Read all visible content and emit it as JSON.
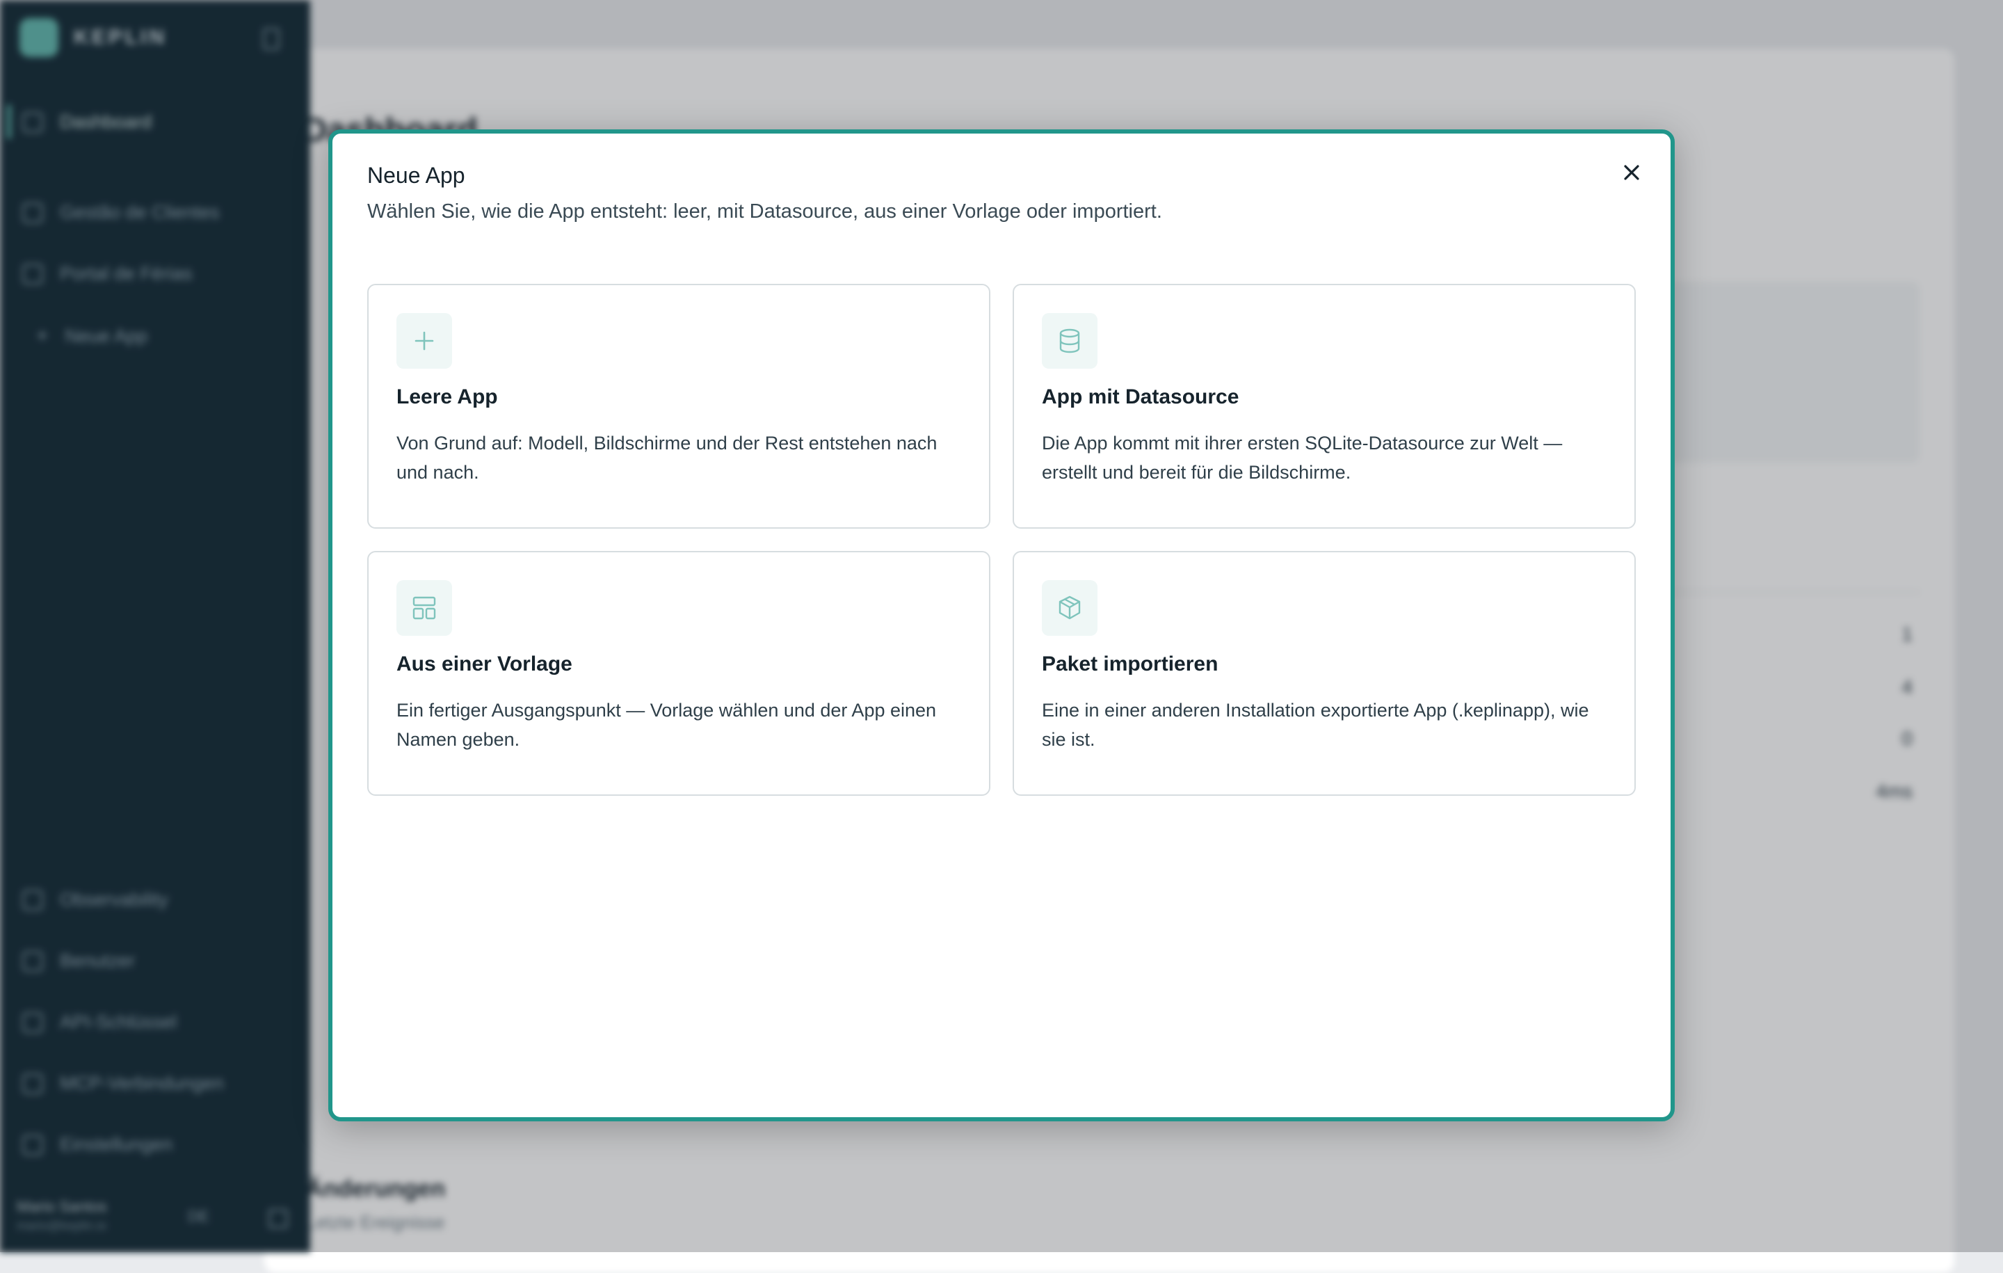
{
  "colors": {
    "accent": "#21968b",
    "sidebar_bg": "#0f2733",
    "icon_tint": "#7fc4bc"
  },
  "sidebar": {
    "brand": "KEPLIN",
    "items": [
      {
        "label": "Dashboard",
        "icon": "dashboard-icon"
      },
      {
        "label": "Gestão de Clientes",
        "icon": "app-icon"
      },
      {
        "label": "Portal de Férias",
        "icon": "app-icon"
      },
      {
        "label": "Neue App",
        "icon": "plus-icon"
      },
      {
        "label": "Observability",
        "icon": "chart-icon"
      },
      {
        "label": "Benutzer",
        "icon": "users-icon"
      },
      {
        "label": "API-Schlüssel",
        "icon": "key-icon"
      },
      {
        "label": "MCP-Verbindungen",
        "icon": "plug-icon"
      },
      {
        "label": "Einstellungen",
        "icon": "gear-icon"
      }
    ],
    "user_name": "Mario Santos",
    "user_email": "mario@keplin.io",
    "language": "DE"
  },
  "background": {
    "page_title": "Dashboard",
    "numbers": [
      "1",
      "4",
      "0",
      "4ms"
    ],
    "heading": "Änderungen",
    "subheading": "Letzte Ereignisse"
  },
  "modal": {
    "title": "Neue App",
    "description": "Wählen Sie, wie die App entsteht: leer, mit Datasource, aus einer Vorlage oder importiert.",
    "close_icon": "close-icon",
    "options": [
      {
        "icon": "plus-icon",
        "title": "Leere App",
        "text": "Von Grund auf: Modell, Bildschirme und der Rest entstehen nach und nach."
      },
      {
        "icon": "database-icon",
        "title": "App mit Datasource",
        "text": "Die App kommt mit ihrer ersten SQLite-Datasource zur Welt — erstellt und bereit für die Bildschirme."
      },
      {
        "icon": "template-icon",
        "title": "Aus einer Vorlage",
        "text": "Ein fertiger Ausgangspunkt — Vorlage wählen und der App einen Namen geben."
      },
      {
        "icon": "package-icon",
        "title": "Paket importieren",
        "text": "Eine in einer anderen Installation exportierte App (.keplinapp), wie sie ist."
      }
    ]
  }
}
